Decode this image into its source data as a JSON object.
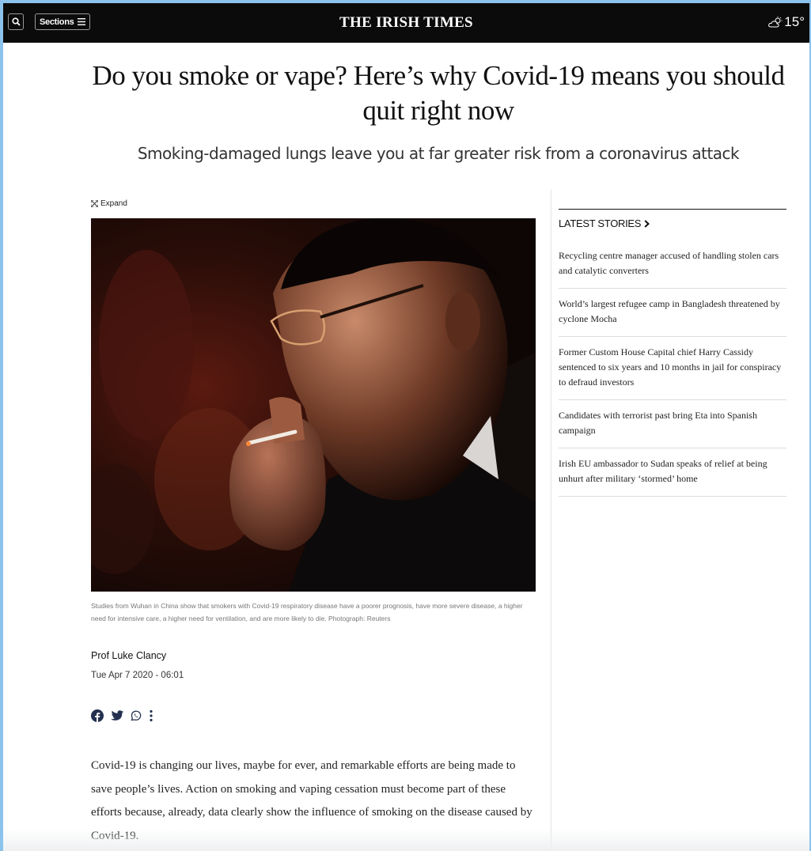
{
  "header": {
    "sections_label": "Sections",
    "masthead": "THE IRISH TIMES",
    "temperature": "15°",
    "icons": {
      "search": "search-icon",
      "menu": "hamburger-icon",
      "weather": "cloud-sun-icon"
    }
  },
  "article": {
    "headline": "Do you smoke or vape? Here’s why Covid-19 means you should quit right now",
    "standfirst": "Smoking-damaged lungs leave you at far greater risk from a coronavirus attack",
    "expand_label": "Expand",
    "photo_caption": "Studies from Wuhan in China show that smokers with Covid-19 respiratory disease have a poorer prognosis, have more severe disease, a higher need for intensive care, a higher need for ventilation, and are more likely to die. Photograph: Reuters",
    "author": "Prof Luke Clancy",
    "date": "Tue Apr 7 2020 - 06:01",
    "share_icons": [
      "facebook-icon",
      "twitter-icon",
      "whatsapp-icon",
      "more-options-icon"
    ],
    "body": "Covid-19 is changing our lives, maybe for ever, and remarkable efforts are being made to save people’s lives. Action on smoking and vaping cessation must become part of these efforts because, already, data clearly show the influence of smoking on the disease caused by Covid-19."
  },
  "sidebar": {
    "title": "LATEST STORIES",
    "stories": [
      "Recycling centre manager accused of handling stolen cars and catalytic converters",
      "World’s largest refugee camp in Bangladesh threatened by cyclone Mocha",
      "Former Custom House Capital chief Harry Cassidy sentenced to six years and 10 months in jail for conspiracy to defraud investors",
      "Candidates with terrorist past bring Eta into Spanish campaign",
      "Irish EU ambassador to Sudan speaks of relief at being unhurt after military ‘stormed’ home"
    ]
  },
  "colors": {
    "topbar": "#0b0b0b",
    "background_frame": "#8cc3ec",
    "share_icon": "#23314f"
  }
}
